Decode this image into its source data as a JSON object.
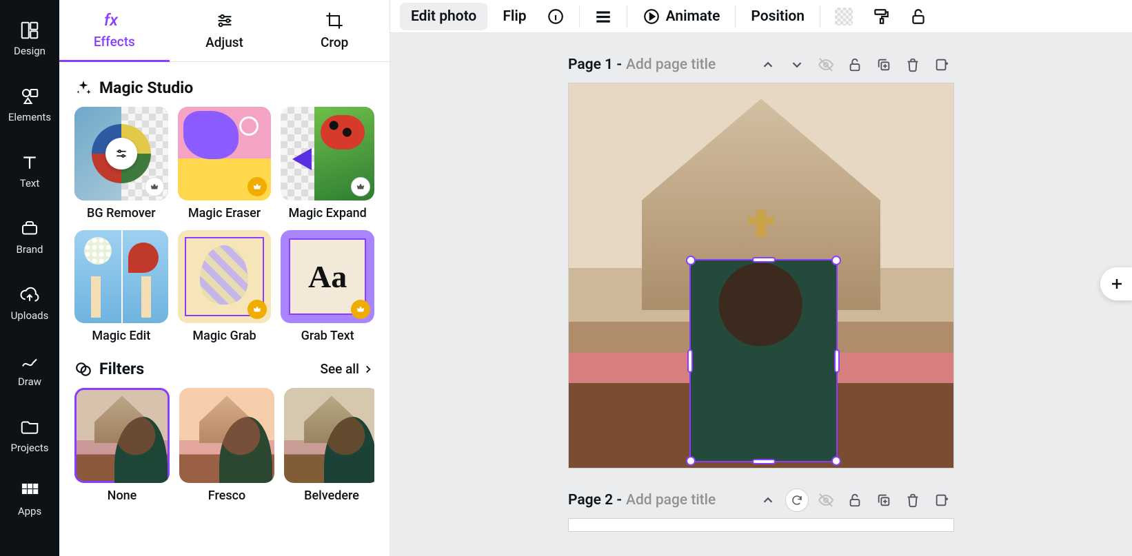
{
  "nav_rail": [
    {
      "key": "design",
      "label": "Design"
    },
    {
      "key": "elements",
      "label": "Elements"
    },
    {
      "key": "text",
      "label": "Text"
    },
    {
      "key": "brand",
      "label": "Brand"
    },
    {
      "key": "uploads",
      "label": "Uploads"
    },
    {
      "key": "draw",
      "label": "Draw"
    },
    {
      "key": "projects",
      "label": "Projects"
    },
    {
      "key": "apps",
      "label": "Apps"
    }
  ],
  "panel_tabs": {
    "effects": "Effects",
    "adjust": "Adjust",
    "crop": "Crop",
    "active": "effects"
  },
  "magic_studio": {
    "title": "Magic Studio",
    "items": [
      {
        "key": "bg-remover",
        "label": "BG Remover",
        "selected": true,
        "premium_badge": "white"
      },
      {
        "key": "magic-eraser",
        "label": "Magic Eraser",
        "premium_badge": "gold"
      },
      {
        "key": "magic-expand",
        "label": "Magic Expand",
        "premium_badge": "white"
      },
      {
        "key": "magic-edit",
        "label": "Magic Edit"
      },
      {
        "key": "magic-grab",
        "label": "Magic Grab",
        "premium_badge": "gold"
      },
      {
        "key": "grab-text",
        "label": "Grab Text",
        "premium_badge": "gold"
      }
    ]
  },
  "filters": {
    "title": "Filters",
    "see_all": "See all",
    "items": [
      {
        "key": "none",
        "label": "None",
        "selected": true
      },
      {
        "key": "fresco",
        "label": "Fresco"
      },
      {
        "key": "belvedere",
        "label": "Belvedere"
      }
    ]
  },
  "toolbar": {
    "edit_photo": "Edit photo",
    "flip": "Flip",
    "animate": "Animate",
    "position": "Position"
  },
  "pages": [
    {
      "prefix": "Page 1 - ",
      "placeholder": "Add page title"
    },
    {
      "prefix": "Page 2 - ",
      "placeholder": "Add page title"
    }
  ],
  "colors": {
    "accent": "#8b3dff",
    "nav_bg": "#0d1216",
    "workspace_bg": "#ebecee"
  }
}
